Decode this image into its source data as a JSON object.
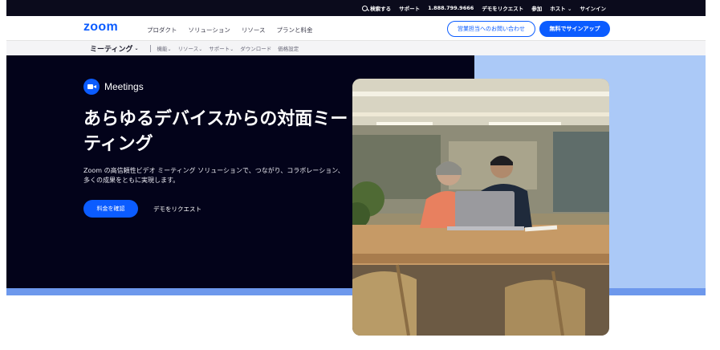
{
  "utility_bar": {
    "search_label": "検索する",
    "support": "サポート",
    "phone": "1.888.799.9666",
    "demo": "デモをリクエスト",
    "join": "参加",
    "host": "ホスト",
    "host_caret": "⌄",
    "signin": "サインイン"
  },
  "nav": {
    "logo": "zoom",
    "links": [
      "プロダクト",
      "ソリューション",
      "リソース",
      "プランと料金"
    ],
    "contact_sales": "営業担当へのお問い合わせ",
    "signup_free": "無料でサインアップ"
  },
  "subnav": {
    "title": "ミーティング",
    "title_caret": "⌄",
    "links": [
      {
        "label": "機能",
        "caret": "⌄"
      },
      {
        "label": "リソース",
        "caret": "⌄"
      },
      {
        "label": "サポート",
        "caret": "⌄"
      },
      {
        "label": "ダウンロード",
        "caret": ""
      },
      {
        "label": "価格設定",
        "caret": ""
      }
    ]
  },
  "hero": {
    "badge": "Meetings",
    "headline": "あらゆるデバイスからの対面ミーティング",
    "subtext": "Zoom の高信頼性ビデオ ミーティング ソリューションで、つながり、コラボレーション、多くの成果をともに実現します。",
    "cta_primary": "料金を確認",
    "cta_secondary": "デモをリクエスト"
  },
  "colors": {
    "brand_blue": "#0b5cff",
    "hero_dark": "#03031a",
    "hero_light_blue": "#abc9f7",
    "hero_strip": "#6d98ec"
  },
  "icons": {
    "search": "search-icon",
    "meetings": "video-camera-icon"
  }
}
